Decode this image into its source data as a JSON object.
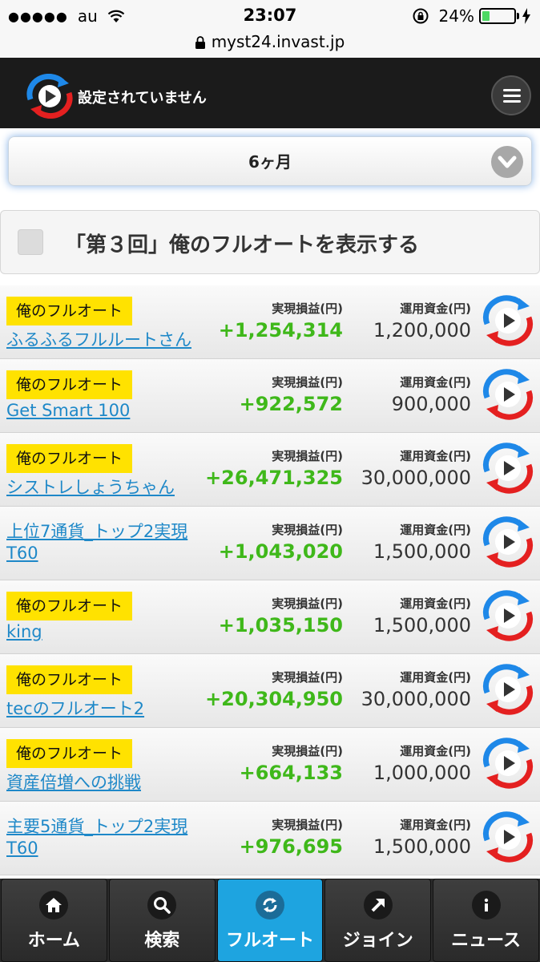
{
  "status": {
    "carrier": "au",
    "time": "23:07",
    "battery": "24%",
    "battery_level": 0.24
  },
  "url": "myst24.invast.jp",
  "header": {
    "title": "設定されていません"
  },
  "period": {
    "selected": "6ヶ月"
  },
  "filter": {
    "label": "「第３回」俺のフルオートを表示する",
    "checked": false
  },
  "columns": {
    "profit": "実現損益(円)",
    "capital": "運用資金(円)"
  },
  "rows": [
    {
      "tag": "俺のフルオート",
      "name": "ふるふるフルルートさん",
      "profit": "+1,254,314",
      "capital": "1,200,000"
    },
    {
      "tag": "俺のフルオート",
      "name": "Get Smart 100",
      "profit": "+922,572",
      "capital": "900,000"
    },
    {
      "tag": "俺のフルオート",
      "name": "シストレしょうちゃん",
      "profit": "+26,471,325",
      "capital": "30,000,000"
    },
    {
      "tag": "",
      "name": "上位7通貨_トップ2実現T60",
      "profit": "+1,043,020",
      "capital": "1,500,000"
    },
    {
      "tag": "俺のフルオート",
      "name": "king",
      "profit": "+1,035,150",
      "capital": "1,500,000"
    },
    {
      "tag": "俺のフルオート",
      "name": "tecのフルオート2",
      "profit": "+20,304,950",
      "capital": "30,000,000"
    },
    {
      "tag": "俺のフルオート",
      "name": "資産倍増への挑戦",
      "profit": "+664,133",
      "capital": "1,000,000"
    },
    {
      "tag": "",
      "name": "主要5通貨_トップ2実現T60",
      "profit": "+976,695",
      "capital": "1,500,000"
    }
  ],
  "tabs": [
    {
      "label": "ホーム",
      "icon": "home-icon"
    },
    {
      "label": "検索",
      "icon": "search-icon"
    },
    {
      "label": "フルオート",
      "icon": "refresh-icon"
    },
    {
      "label": "ジョイン",
      "icon": "arrow-up-right-icon"
    },
    {
      "label": "ニュース",
      "icon": "info-icon"
    }
  ],
  "colors": {
    "header_bg": "#1b1b1b",
    "tag_yellow": "#ffe200",
    "profit_green": "#3fb81a",
    "link_blue": "#1e88c8",
    "active_tab": "#1ea4e0"
  }
}
